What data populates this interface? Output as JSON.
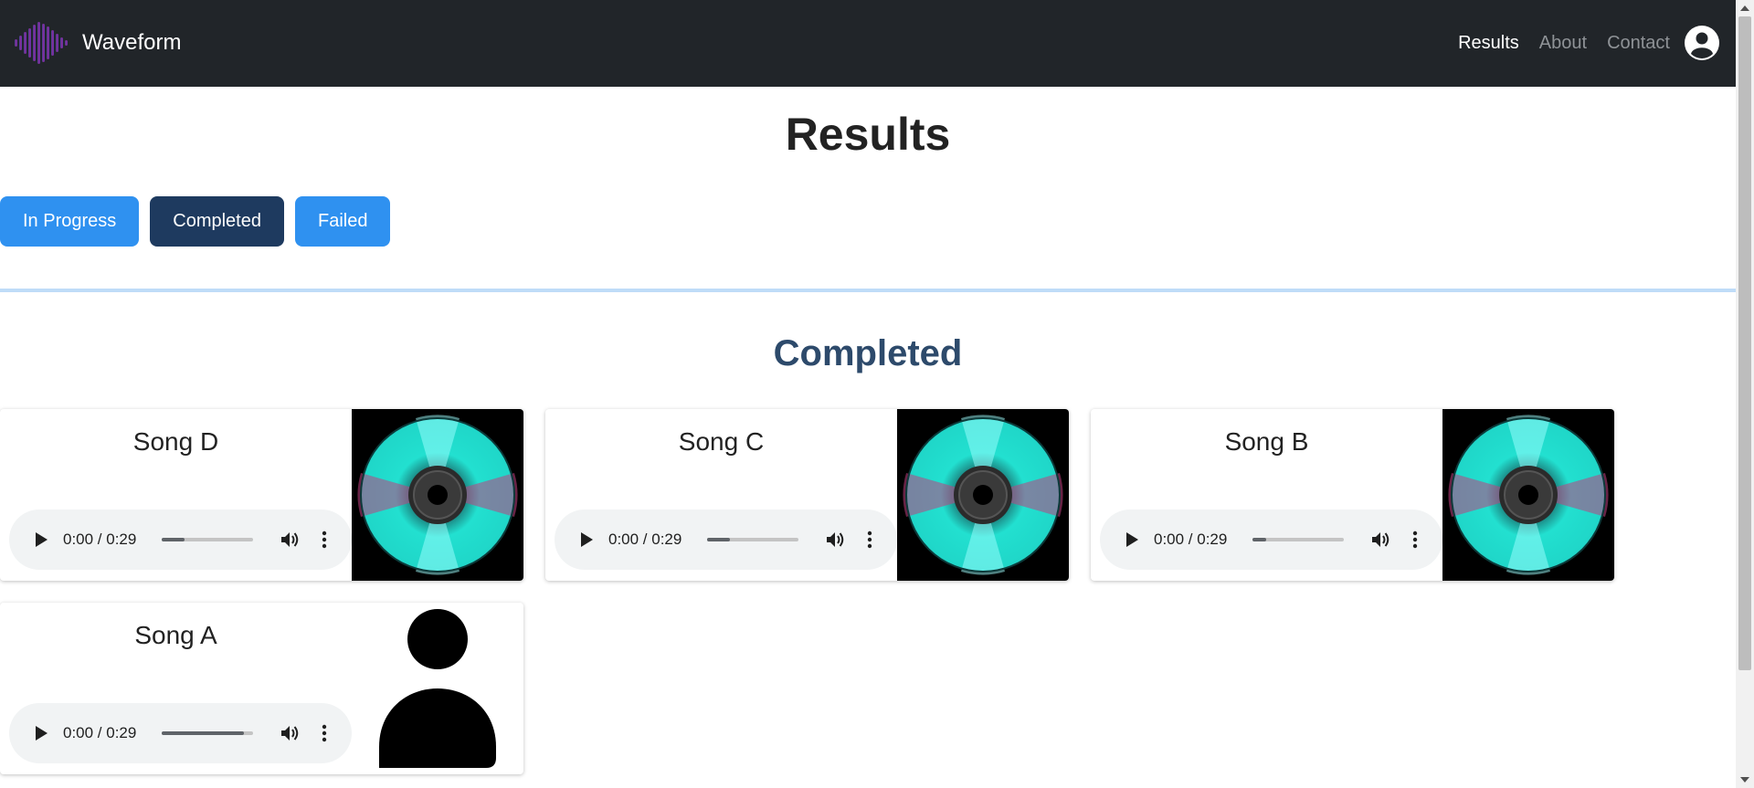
{
  "navbar": {
    "brand": "Waveform",
    "links": [
      {
        "label": "Results",
        "active": true
      },
      {
        "label": "About",
        "active": false
      },
      {
        "label": "Contact",
        "active": false
      }
    ]
  },
  "page_title": "Results",
  "tabs": [
    {
      "label": "In Progress",
      "active": false
    },
    {
      "label": "Completed",
      "active": true
    },
    {
      "label": "Failed",
      "active": false
    }
  ],
  "section_title": "Completed",
  "songs": [
    {
      "title": "Song D",
      "time": "0:00 / 0:29",
      "progress": 0.25,
      "art": "cd-disc-icon"
    },
    {
      "title": "Song C",
      "time": "0:00 / 0:29",
      "progress": 0.25,
      "art": "cd-disc-icon"
    },
    {
      "title": "Song B",
      "time": "0:00 / 0:29",
      "progress": 0.15,
      "art": "cd-disc-icon"
    },
    {
      "title": "Song A",
      "time": "0:00 / 0:29",
      "progress": 0.9,
      "art": "person-icon"
    }
  ],
  "colors": {
    "navbar_bg": "#212529",
    "tab_default": "#2f91f0",
    "tab_active": "#1e3a5f",
    "section_title": "#2d4a6b",
    "divider": "#bfdcf8"
  }
}
